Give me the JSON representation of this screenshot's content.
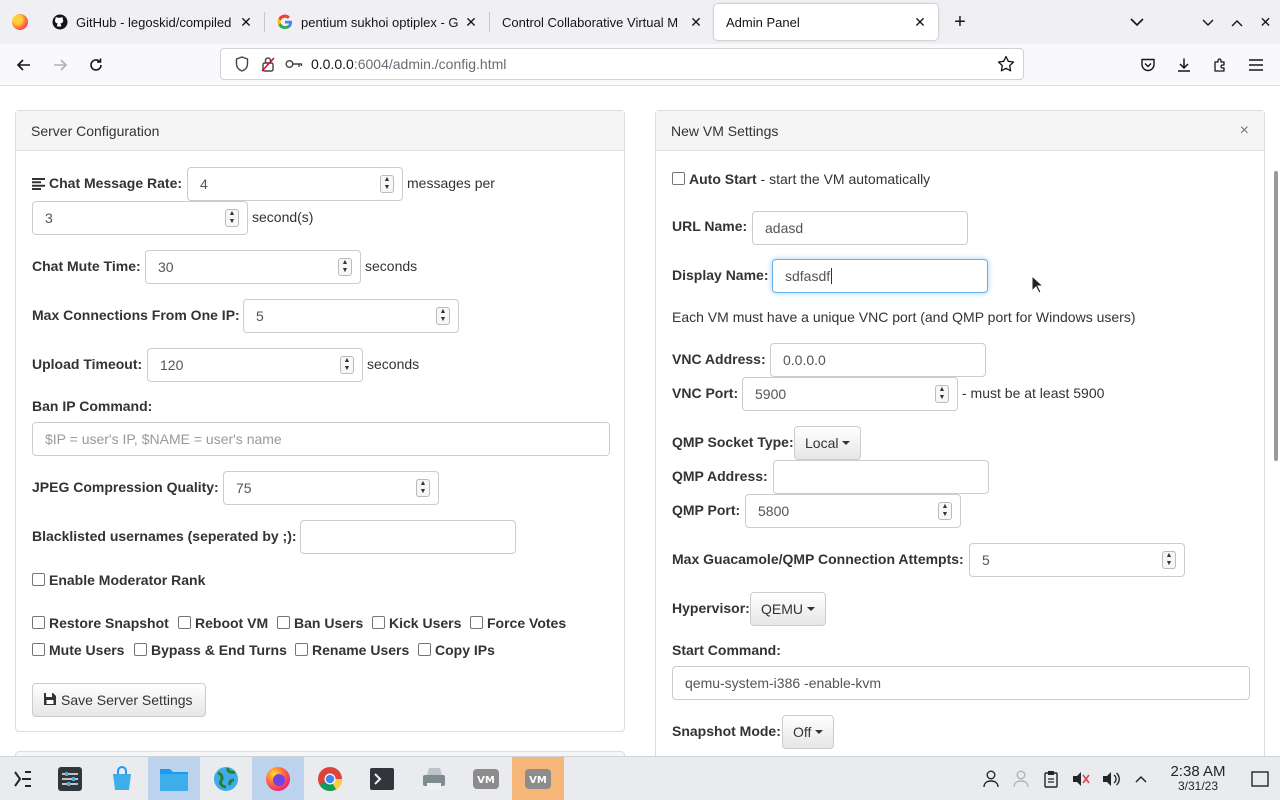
{
  "browser": {
    "tabs": [
      {
        "title": "GitHub - legoskid/compiled",
        "icon": "github-icon",
        "active": false
      },
      {
        "title": "pentium sukhoi optiplex - G",
        "icon": "google-icon",
        "active": false
      },
      {
        "title": "Control Collaborative Virtual M",
        "icon": "none",
        "active": false
      },
      {
        "title": "Admin Panel",
        "icon": "none",
        "active": true
      }
    ],
    "url_host": "0.0.0.0",
    "url_rest": ":6004/admin./config.html"
  },
  "server_config": {
    "title": "Server Configuration",
    "chat_rate_label": "Chat Message Rate:",
    "chat_rate_value": "4",
    "messages_per": "messages per",
    "chat_rate_seconds_value": "3",
    "seconds_suffix": "second(s)",
    "mute_label": "Chat Mute Time:",
    "mute_value": "30",
    "seconds": "seconds",
    "max_conn_label": "Max Connections From One IP:",
    "max_conn_value": "5",
    "upload_label": "Upload Timeout:",
    "upload_value": "120",
    "ban_ip_label": "Ban IP Command:",
    "ban_ip_placeholder": "$IP = user's IP, $NAME = user's name",
    "jpeg_label": "JPEG Compression Quality:",
    "jpeg_value": "75",
    "blacklist_label": "Blacklisted usernames (seperated by ;):",
    "blacklist_value": "",
    "mod_rank_label": "Enable Moderator Rank",
    "perms": [
      "Restore Snapshot",
      "Reboot VM",
      "Ban Users",
      "Kick Users",
      "Force Votes",
      "Mute Users",
      "Bypass & End Turns",
      "Rename Users",
      "Copy IPs"
    ],
    "save_label": "Save Server Settings"
  },
  "vm_settings": {
    "title": "New VM Settings",
    "close": "×",
    "auto_start_label": "Auto Start",
    "auto_start_desc": " - start the VM automatically",
    "url_name_label": "URL Name:",
    "url_name_value": "adasd",
    "display_name_label": "Display Name:",
    "display_name_value": "sdfasdf",
    "vnc_note": "Each VM must have a unique VNC port (and QMP port for Windows users)",
    "vnc_addr_label": "VNC Address:",
    "vnc_addr_value": "0.0.0.0",
    "vnc_port_label": "VNC Port:",
    "vnc_port_value": "5900",
    "vnc_port_note": "- must be at least 5900",
    "qmp_type_label": "QMP Socket Type:",
    "qmp_type_value": "Local",
    "qmp_addr_label": "QMP Address:",
    "qmp_addr_value": "",
    "qmp_port_label": "QMP Port:",
    "qmp_port_value": "5800",
    "max_attempts_label": "Max Guacamole/QMP Connection Attempts:",
    "max_attempts_value": "5",
    "hypervisor_label": "Hypervisor:",
    "hypervisor_value": "QEMU",
    "start_cmd_label": "Start Command:",
    "start_cmd_value": "qemu-system-i386 -enable-kvm",
    "snapshot_label": "Snapshot Mode:",
    "snapshot_value": "Off"
  },
  "taskbar": {
    "time": "2:38 AM",
    "date": "3/31/23"
  }
}
